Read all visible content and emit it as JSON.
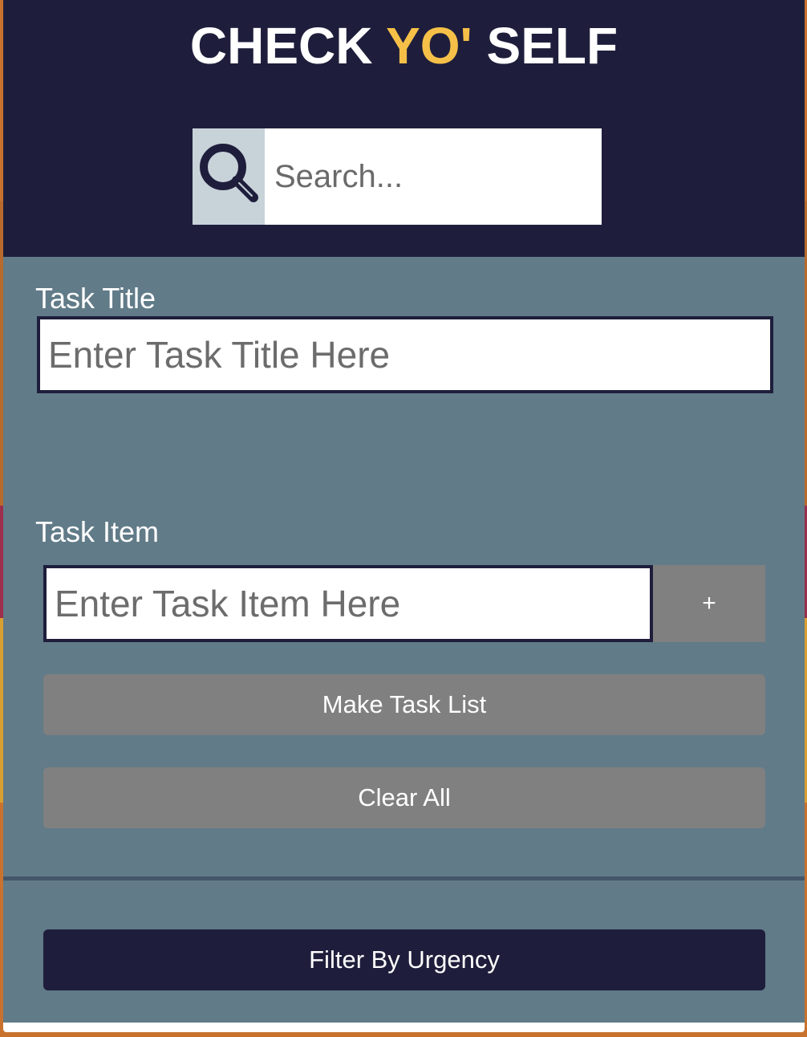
{
  "header": {
    "title_part1": "CHECK ",
    "title_accent": "YO'",
    "title_part2": " SELF",
    "accent_color": "#f6c048",
    "background_color": "#1e1e3c"
  },
  "search": {
    "placeholder": "Search...",
    "icon": "magnifying-glass"
  },
  "form": {
    "task_title_label": "Task Title",
    "task_title_placeholder": "Enter Task Title Here",
    "task_item_label": "Task Item",
    "task_item_placeholder": "Enter Task Item Here",
    "add_item_label": "+",
    "make_list_label": "Make Task List",
    "clear_all_label": "Clear All",
    "filter_label": "Filter By Urgency"
  },
  "colors": {
    "panel": "#617b88",
    "button_gray": "#808080",
    "button_dark": "#1e1e3c"
  }
}
